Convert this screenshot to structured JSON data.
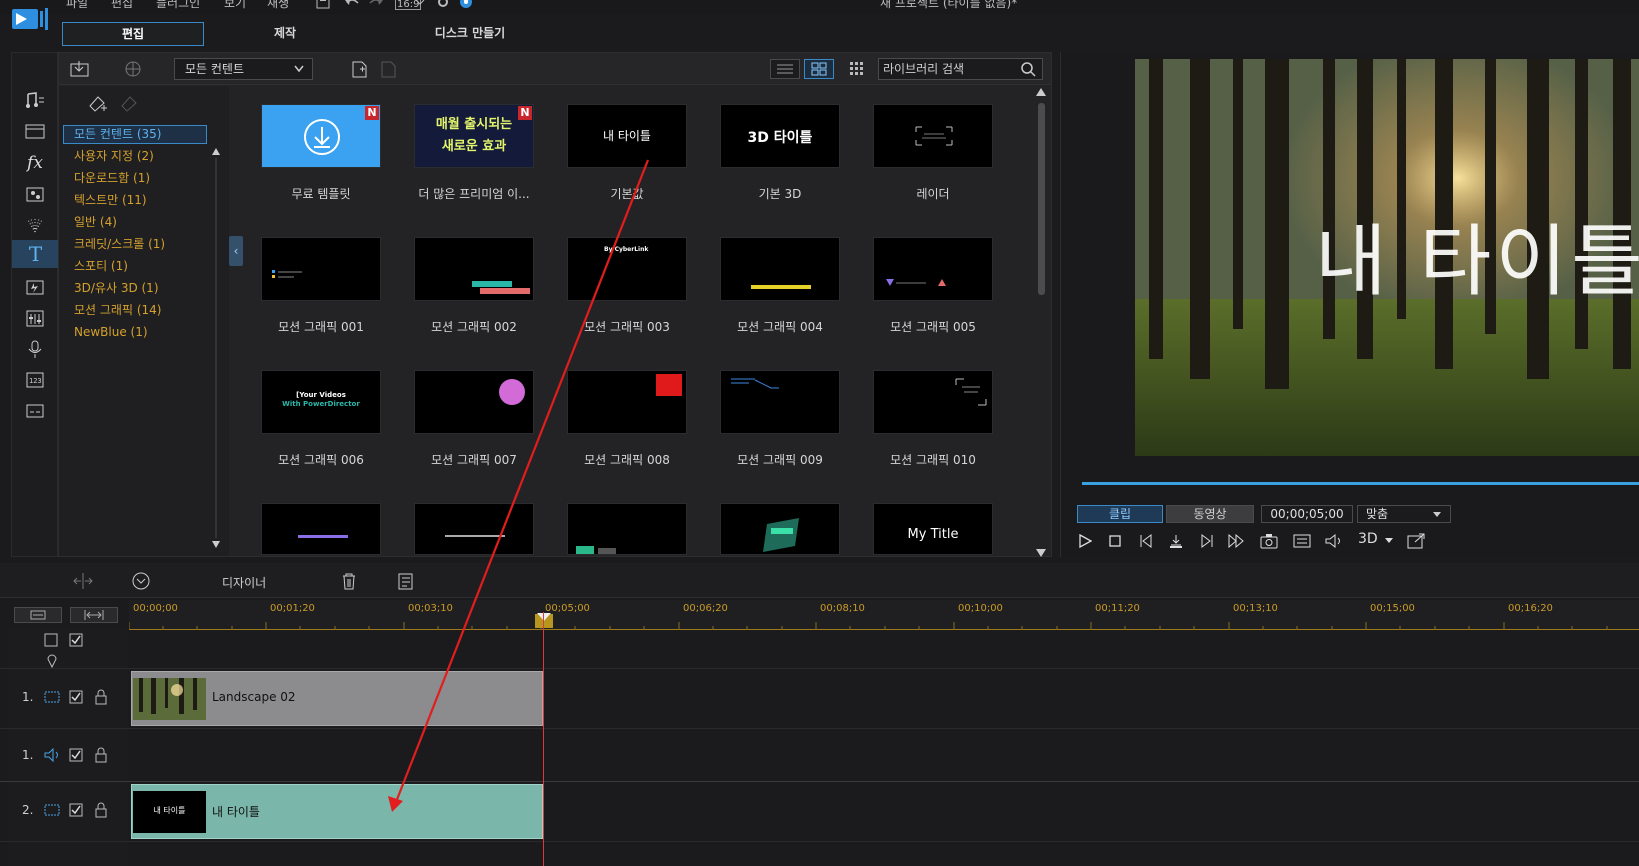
{
  "menu": {
    "items": [
      "파일",
      "편집",
      "플러그인",
      "보기",
      "재생"
    ],
    "aspect": "16:9"
  },
  "window_title": "새 프로젝트 (타이틀 없음)*",
  "modes": [
    "편집",
    "제작",
    "디스크 만들기"
  ],
  "library": {
    "content_filter": "모든 컨텐트",
    "search_placeholder": "라이브러리 검색",
    "categories": [
      "모든 컨텐트  (35)",
      "사용자 지정  (2)",
      "다운로드함  (1)",
      "텍스트만  (11)",
      "일반  (4)",
      "크레딧/스크롤  (1)",
      "스포티  (1)",
      "3D/유사 3D  (1)",
      "모션 그래픽  (14)",
      "NewBlue  (1)"
    ],
    "items": [
      {
        "label": "무료 템플릿",
        "badge": "N"
      },
      {
        "label": "더 많은 프리미엄 이...",
        "badge": "N",
        "thumb_text_1": "매월 출시되는",
        "thumb_text_2": "새로운 효과"
      },
      {
        "label": "기본값",
        "thumb_text_1": "내 타이틀"
      },
      {
        "label": "기본 3D",
        "thumb_text_1": "3D 타이틀"
      },
      {
        "label": "레이더"
      },
      {
        "label": "모션 그래픽 001"
      },
      {
        "label": "모션 그래픽 002"
      },
      {
        "label": "모션 그래픽 003",
        "thumb_text_1": "By CyberLink"
      },
      {
        "label": "모션 그래픽 004"
      },
      {
        "label": "모션 그래픽 005"
      },
      {
        "label": "모션 그래픽 006",
        "thumb_text_1": "[Your Videos",
        "thumb_text_2": "With PowerDirector"
      },
      {
        "label": "모션 그래픽 007"
      },
      {
        "label": "모션 그래픽 008"
      },
      {
        "label": "모션 그래픽 009"
      },
      {
        "label": "모션 그래픽 010"
      },
      {
        "label": ""
      },
      {
        "label": ""
      },
      {
        "label": ""
      },
      {
        "label": ""
      },
      {
        "label": "",
        "thumb_text_1": "My Title"
      }
    ]
  },
  "preview": {
    "title_overlay": "내 타이틀",
    "mode_clip": "클립",
    "mode_movie": "동영상",
    "timecode": "00;00;05;00",
    "fit": "맞춤",
    "threed": "3D",
    "progress": 1.0
  },
  "timeline": {
    "designer_label": "디자이너",
    "ruler_labels": [
      "00;00;00",
      "00;01;20",
      "00;03;10",
      "00;05;00",
      "00;06;20",
      "00;08;10",
      "00;10;00",
      "00;11;20",
      "00;13;10",
      "00;15;00",
      "00;16;20"
    ],
    "tracks": [
      {
        "number": "1.",
        "type": "video"
      },
      {
        "number": "1.",
        "type": "audio"
      },
      {
        "number": "2.",
        "type": "video"
      }
    ],
    "clips": [
      {
        "label": "Landscape 02",
        "track": "1-video"
      },
      {
        "label": "내 타이틀",
        "thumb_text": "내 타이틀",
        "track": "2-video"
      }
    ]
  },
  "colors": {
    "accent": "#3a89c9",
    "category_text": "#d4a12d",
    "title_clip": "#7ab7aa",
    "playhead": "#d93b3b",
    "annotation_arrow": "#e11d1d"
  }
}
